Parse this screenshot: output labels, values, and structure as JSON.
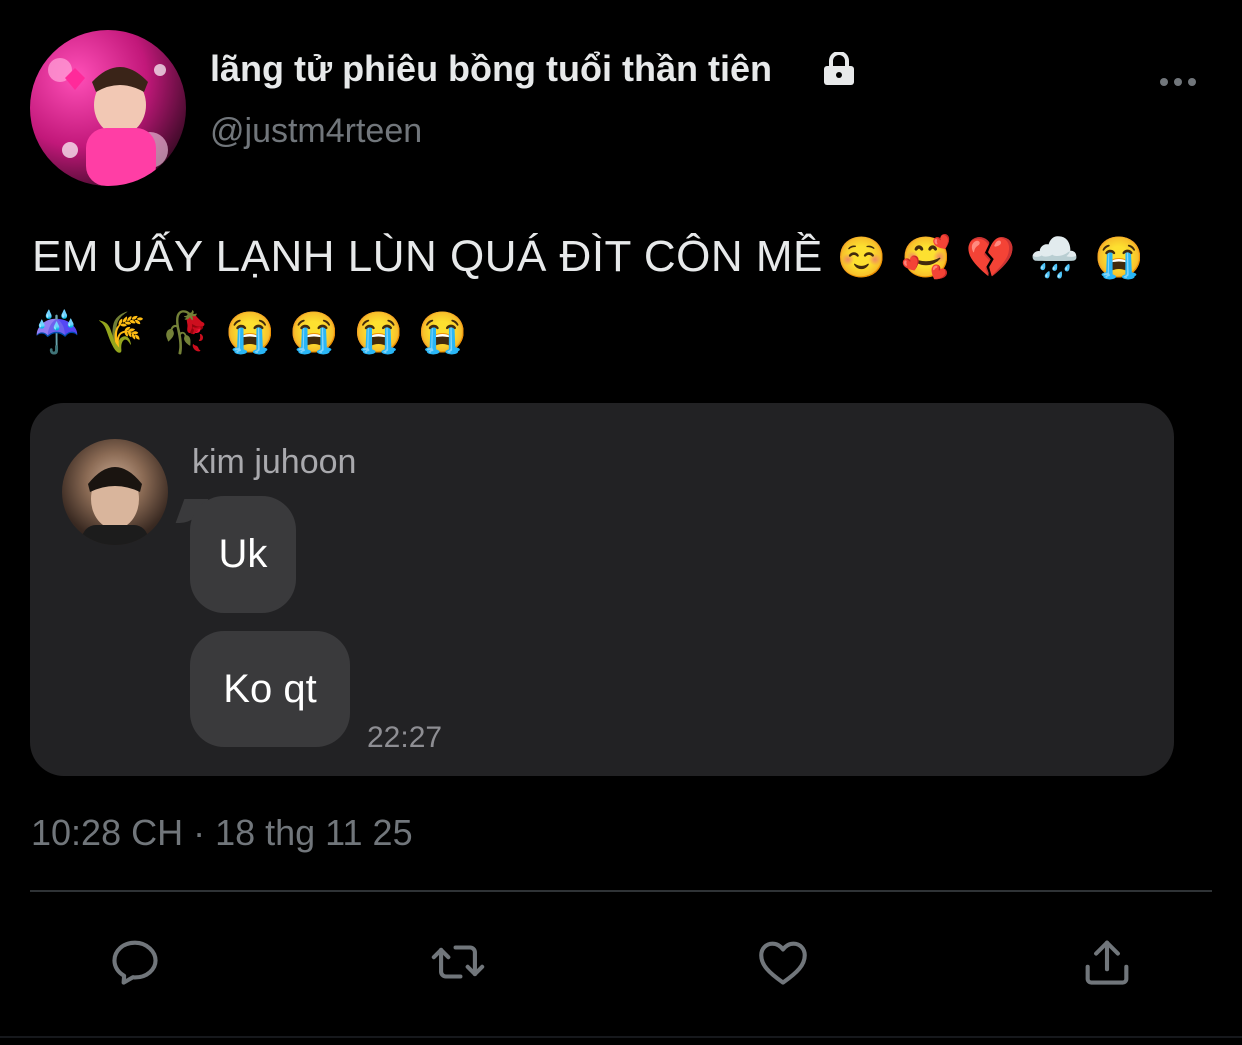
{
  "tweet": {
    "author": {
      "display_name": "lãng tử phiêu bồng tuổi thần tiên",
      "handle": "@justm4rteen",
      "protected_icon": "lock-icon"
    },
    "text": "EM UẤY LẠNH LÙN QUÁ ĐÌT CÔN MỀ",
    "emojis": [
      "☺️",
      "🥰",
      "💔",
      "🌧️",
      "😭",
      "☔",
      "🌾",
      "🥀",
      "😭",
      "😭",
      "😭",
      "😭"
    ],
    "timestamp": "10:28 CH · 18 thg 11 25"
  },
  "media": {
    "sender_name": "kim juhoon",
    "messages": [
      "Uk",
      "Ko qt"
    ],
    "message_time": "22:27"
  },
  "actions": {
    "reply_icon": "reply-icon",
    "retweet_icon": "retweet-icon",
    "like_icon": "heart-icon",
    "share_icon": "share-icon"
  },
  "colors": {
    "background": "#000000",
    "text_primary": "#e7e9ea",
    "text_secondary": "#71767b",
    "card_background": "#222224",
    "bubble_background": "#3a3a3c"
  }
}
